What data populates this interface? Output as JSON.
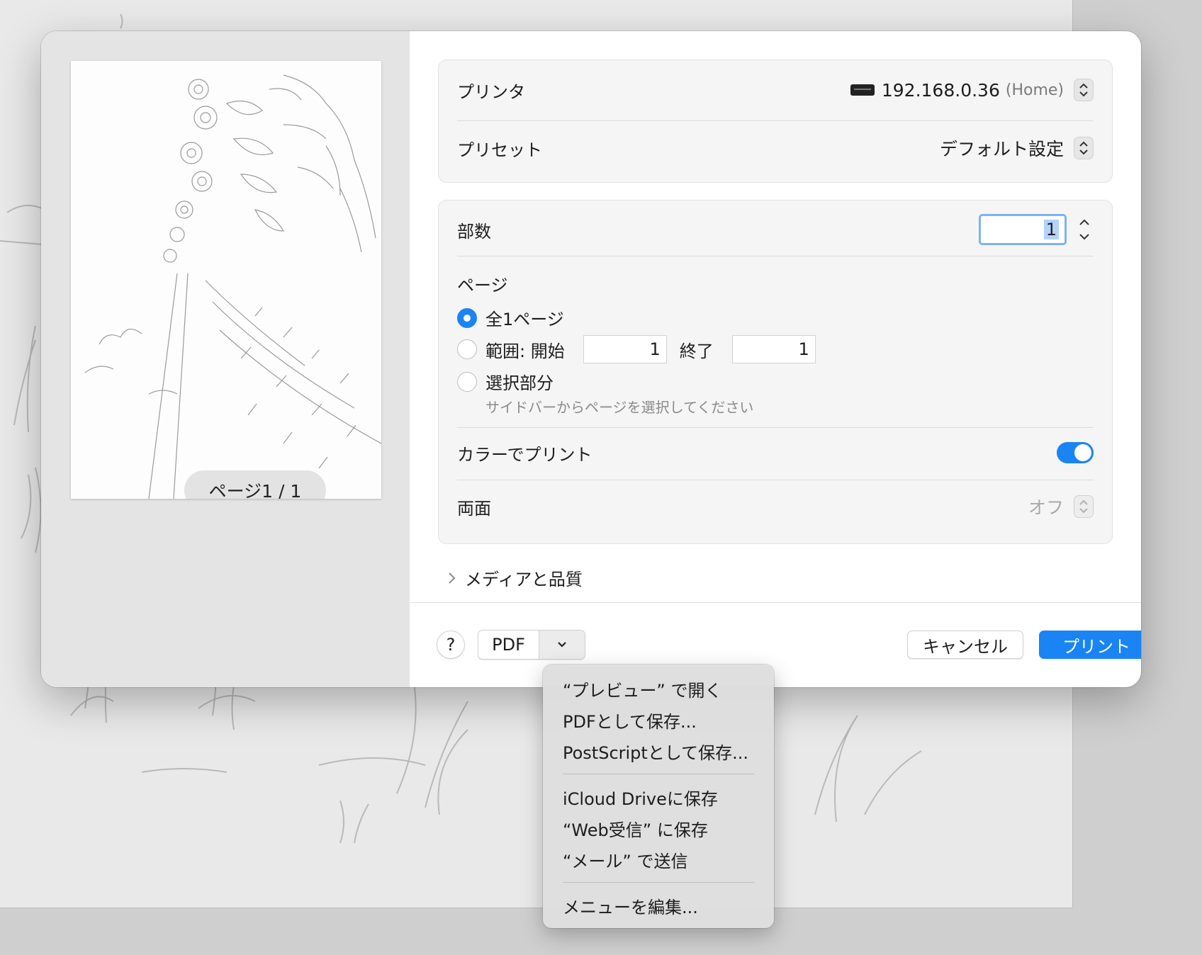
{
  "preview": {
    "page_badge": "ページ1 / 1"
  },
  "printer": {
    "label": "プリンタ",
    "value": "192.168.0.36",
    "location": "(Home)"
  },
  "preset": {
    "label": "プリセット",
    "value": "デフォルト設定"
  },
  "copies": {
    "label": "部数",
    "value": "1"
  },
  "pages": {
    "label": "ページ",
    "all_option": "全1ページ",
    "range_option": "範囲: 開始",
    "range_from": "1",
    "range_to_label": "終了",
    "range_to": "1",
    "selection_option": "選択部分",
    "selection_hint": "サイドバーからページを選択してください",
    "selected": "all"
  },
  "color": {
    "label": "カラーでプリント",
    "enabled": true
  },
  "duplex": {
    "label": "両面",
    "value": "オフ"
  },
  "media_quality": {
    "label": "メディアと品質"
  },
  "footer": {
    "help_label": "?",
    "pdf_label": "PDF",
    "cancel_label": "キャンセル",
    "print_label": "プリント"
  },
  "pdf_menu": {
    "group1": [
      "“プレビュー” で開く",
      "PDFとして保存...",
      "PostScriptとして保存..."
    ],
    "group2": [
      "iCloud Driveに保存",
      "“Web受信” に保存",
      "“メール” で送信"
    ],
    "group3": [
      "メニューを編集..."
    ]
  },
  "colors": {
    "accent": "#1a84f5",
    "sidebar_bg": "#e4e4e4",
    "group_bg": "#f5f5f5"
  }
}
